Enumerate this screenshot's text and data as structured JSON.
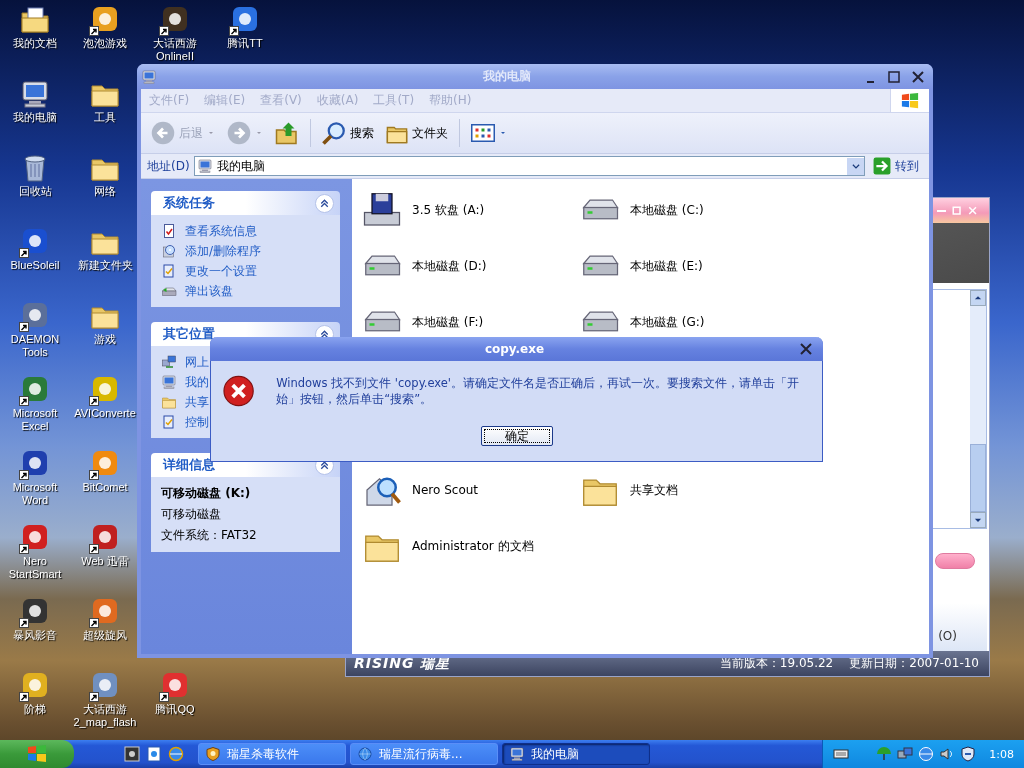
{
  "desktop": {
    "icon_columns": [
      [
        {
          "label": "我的文档",
          "kind": "documents",
          "shortcut": false
        },
        {
          "label": "我的电脑",
          "kind": "computer",
          "shortcut": false
        },
        {
          "label": "回收站",
          "kind": "recycle",
          "shortcut": false
        },
        {
          "label": "BlueSoleil",
          "kind": "app",
          "color": "#1a4fd0",
          "shortcut": true
        },
        {
          "label": "DAEMON Tools",
          "kind": "app",
          "color": "#5b6f9a",
          "shortcut": true
        },
        {
          "label": "Microsoft Excel",
          "kind": "app",
          "color": "#2a7a3a",
          "shortcut": true
        },
        {
          "label": "Microsoft Word",
          "kind": "app",
          "color": "#1f3fae",
          "shortcut": true
        },
        {
          "label": "Nero StartSmart",
          "kind": "app",
          "color": "#d02020",
          "shortcut": true
        },
        {
          "label": "暴风影音",
          "kind": "app",
          "color": "#333333",
          "shortcut": true
        },
        {
          "label": "阶梯",
          "kind": "app",
          "color": "#e0b020",
          "shortcut": true
        }
      ],
      [
        {
          "label": "泡泡游戏",
          "kind": "app",
          "color": "#e8a020",
          "shortcut": true
        },
        {
          "label": "工具",
          "kind": "folder",
          "shortcut": false
        },
        {
          "label": "网络",
          "kind": "folder",
          "shortcut": false
        },
        {
          "label": "新建文件夹",
          "kind": "folder",
          "shortcut": false
        },
        {
          "label": "游戏",
          "kind": "folder",
          "shortcut": false
        },
        {
          "label": "AVIConverte",
          "kind": "app",
          "color": "#d8b800",
          "shortcut": true
        },
        {
          "label": "BitComet",
          "kind": "app",
          "color": "#f08a10",
          "shortcut": true
        },
        {
          "label": "Web 迅雷",
          "kind": "app",
          "color": "#c02020",
          "shortcut": true
        },
        {
          "label": "超级旋风",
          "kind": "app",
          "color": "#e06a20",
          "shortcut": true
        },
        {
          "label": "大话西游 2_map_flash",
          "kind": "app",
          "color": "#7090c0",
          "shortcut": true
        }
      ],
      [
        {
          "label": "大话西游 OnlineII",
          "kind": "app",
          "color": "#403020",
          "shortcut": true
        },
        {
          "label": "腾讯QQ",
          "kind": "app",
          "color": "#e03030",
          "shortcut": true
        }
      ],
      [
        {
          "label": "腾讯TT",
          "kind": "app",
          "color": "#2a70e0",
          "shortcut": true
        }
      ]
    ]
  },
  "background_window": {
    "option_label": "(O)",
    "footer": {
      "logo": "RISING 瑞星",
      "version": "当前版本：19.05.22",
      "update_date": "更新日期：2007-01-10"
    }
  },
  "explorer": {
    "title": "我的电脑",
    "active": false,
    "menu": [
      "文件(F)",
      "编辑(E)",
      "查看(V)",
      "收藏(A)",
      "工具(T)",
      "帮助(H)"
    ],
    "toolbar": {
      "back": {
        "label": "后退",
        "disabled": true
      },
      "forward": {
        "disabled": true
      },
      "search": "搜索",
      "folders": "文件夹"
    },
    "address": {
      "label": "地址(D)",
      "value": "我的电脑",
      "go": "转到"
    },
    "sidebar": [
      {
        "kind": "links",
        "title": "系统任务",
        "links": [
          {
            "label": "查看系统信息",
            "kind": "info"
          },
          {
            "label": "添加/删除程序",
            "kind": "programs"
          },
          {
            "label": "更改一个设置",
            "kind": "settings"
          },
          {
            "label": "弹出该盘",
            "kind": "eject"
          }
        ]
      },
      {
        "kind": "links",
        "title": "其它位置",
        "links": [
          {
            "label": "网上",
            "kind": "network"
          },
          {
            "label": "我的",
            "kind": "computer"
          },
          {
            "label": "共享",
            "kind": "folder"
          },
          {
            "label": "控制",
            "kind": "settings"
          }
        ]
      },
      {
        "kind": "details",
        "title": "详细信息",
        "name": "可移动磁盘 (K:)",
        "type": "可移动磁盘",
        "filesystem": "文件系统：FAT32"
      }
    ],
    "drives": [
      {
        "label": "3.5 软盘 (A:)",
        "kind": "floppy"
      },
      {
        "label": "本地磁盘 (C:)",
        "kind": "drive"
      },
      {
        "label": "本地磁盘 (D:)",
        "kind": "drive"
      },
      {
        "label": "本地磁盘 (E:)",
        "kind": "drive"
      },
      {
        "label": "本地磁盘 (F:)",
        "kind": "drive"
      },
      {
        "label": "本地磁盘 (G:)",
        "kind": "drive"
      }
    ],
    "files": [
      {
        "label": "Nero Scout",
        "kind": "magnifier"
      },
      {
        "label": "共享文档",
        "kind": "folder"
      },
      {
        "label": "Administrator 的文档",
        "kind": "folder"
      }
    ]
  },
  "dialog": {
    "title": "copy.exe",
    "message": "Windows 找不到文件 'copy.exe'。请确定文件名是否正确后，再试一次。要搜索文件，请单击「开始」按钮，然后单击“搜索”。",
    "button": "确定"
  },
  "taskbar": {
    "tasks": [
      {
        "label": "瑞星杀毒软件",
        "kind": "shield",
        "selected": false
      },
      {
        "label": "瑞星流行病毒...",
        "kind": "globe",
        "selected": false
      },
      {
        "label": "我的电脑",
        "kind": "computer",
        "selected": true
      }
    ],
    "clock": "1:08"
  }
}
